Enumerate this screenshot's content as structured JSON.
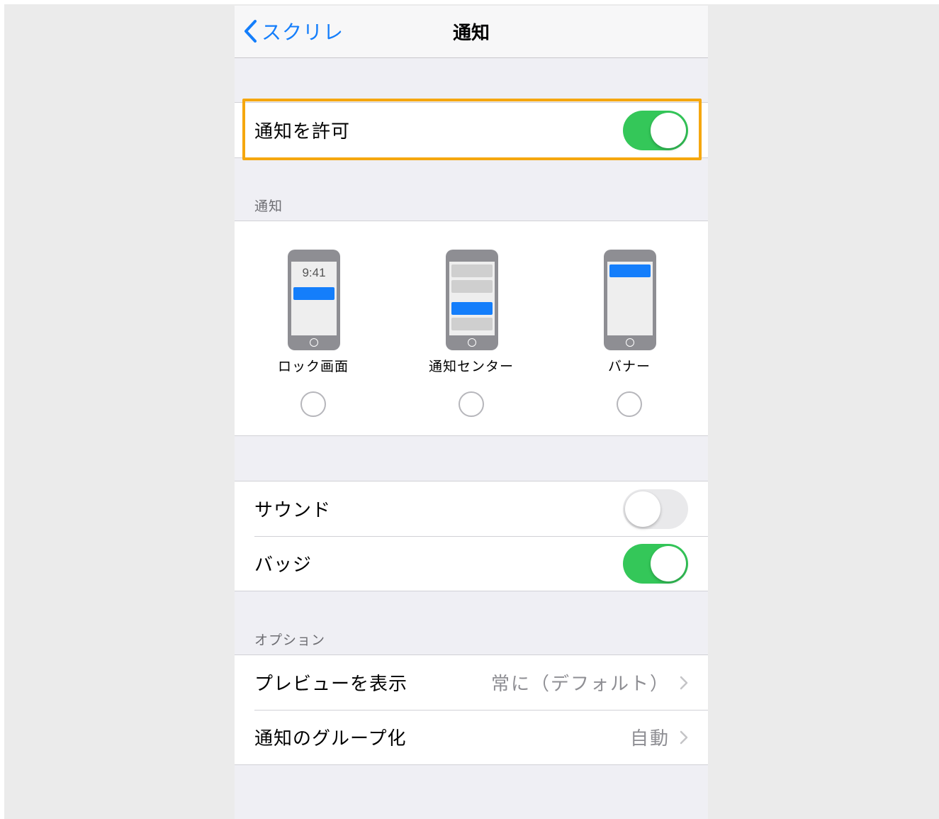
{
  "nav": {
    "back_label": "スクリレ",
    "title": "通知"
  },
  "allow": {
    "label": "通知を許可",
    "state": "on"
  },
  "alerts": {
    "header": "通知",
    "styles": [
      {
        "label": "ロック画面",
        "preview_time": "9:41",
        "selected": false
      },
      {
        "label": "通知センター",
        "selected": false
      },
      {
        "label": "バナー",
        "selected": false
      }
    ]
  },
  "sound_badge": {
    "sound_label": "サウンド",
    "sound_state": "off",
    "badge_label": "バッジ",
    "badge_state": "on"
  },
  "options": {
    "header": "オプション",
    "preview_label": "プレビューを表示",
    "preview_value": "常に（デフォルト）",
    "grouping_label": "通知のグループ化",
    "grouping_value": "自動"
  },
  "colors": {
    "accent": "#147efb",
    "toggle_on": "#34c759",
    "highlight": "#f5a70f"
  }
}
